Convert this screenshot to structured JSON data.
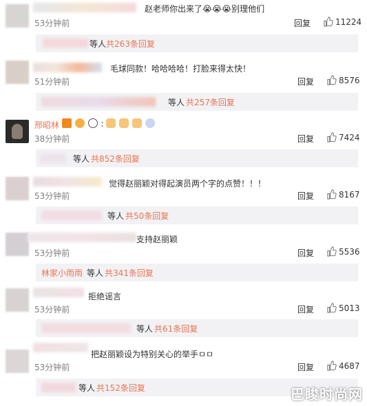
{
  "ui": {
    "reply_label": "回复",
    "sub_suffix": "等人",
    "colors": {
      "link": "#eb7350",
      "sub_bg": "#f2f2f5",
      "time": "#808080"
    },
    "icons": {
      "like": "thumbs-up-icon",
      "avatar": "avatar"
    }
  },
  "comments": [
    {
      "text": "赵老师你出来了😭😭😭别理他们",
      "time": "53分钟前",
      "likes": "11224",
      "sub_count": "共263条回复"
    },
    {
      "text": "毛球同款！哈哈哈哈！打脸来得太快！",
      "time": "51分钟前",
      "likes": "8576",
      "sub_count": "共257条回复"
    },
    {
      "name": "邢昭林",
      "time": "38分钟前",
      "likes": "7424",
      "sub_count": "共852条回复"
    },
    {
      "text": "觉得赵丽颖对得起演员两个字的点赞！！！",
      "time": "53分钟前",
      "likes": "8167",
      "sub_count": "共50条回复"
    },
    {
      "text": "支持赵丽颖",
      "time": "53分钟前",
      "likes": "5536",
      "sub_user": "林家小雨雨",
      "sub_count": "共341条回复"
    },
    {
      "text": "拒绝谣言",
      "time": "53分钟前",
      "likes": "5013",
      "sub_count": "共61条回复"
    },
    {
      "text": "把赵丽颖设为特别关心的举手ㅁㅁ",
      "time": "53分钟前",
      "likes": "4687",
      "sub_count": "共152条回复"
    }
  ],
  "watermark": "巴睃时尚网"
}
